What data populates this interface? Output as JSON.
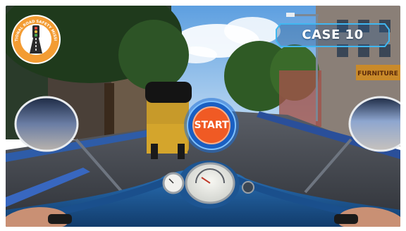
{
  "badge": {
    "text": "NATIONAL ROAD SAFETY MISSION",
    "icon": "traffic-light-road-icon",
    "ring_color": "#f39c33"
  },
  "case": {
    "label": "CASE 10",
    "frame_color": "#3fb6f0"
  },
  "start_button": {
    "label": "START",
    "fill_color": "#f05a24",
    "ring_color": "#1f6fd6"
  },
  "scene": {
    "vehicle": "scooter",
    "shop_sign": "FURNITURE"
  }
}
